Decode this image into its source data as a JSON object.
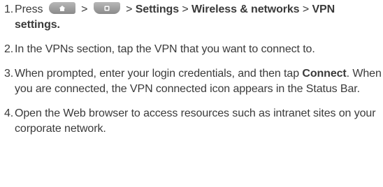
{
  "steps": [
    {
      "num": "1.",
      "t1": "Press",
      "sep1": ">",
      "sep2": ">",
      "settings": "Settings",
      "sep3": ">",
      "wireless": "Wireless & networks",
      "sep4": ">",
      "vpn1": "VPN",
      "vpn2": "settings."
    },
    {
      "num": "2.",
      "text": "In the VPNs section, tap the VPN that you want to connect to."
    },
    {
      "num": "3.",
      "t1": "When prompted, enter your login credentials, and then tap",
      "connect": "Connect",
      "t2": ". When you are connected, the VPN connected icon appears in the Status Bar."
    },
    {
      "num": "4.",
      "text": "Open the Web browser to access resources such as intranet sites on your corporate network."
    }
  ],
  "icons": {
    "home_key": "home-key-icon",
    "menu_key": "menu-key-icon",
    "key_color": "#9a9a9a"
  }
}
